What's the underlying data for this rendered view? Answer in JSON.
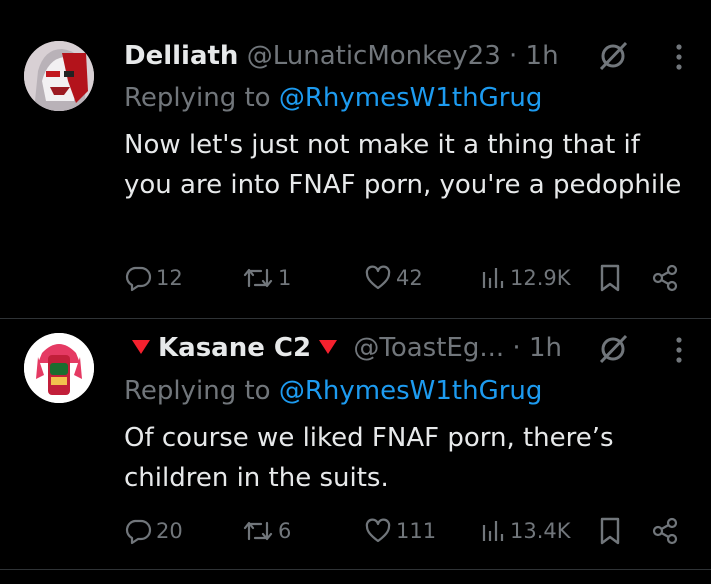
{
  "tweets": [
    {
      "display_name": "Delliath",
      "handle": "@LunaticMonkey23",
      "sep": "·",
      "time": "1h",
      "replying_prefix": "Replying to",
      "replying_to": "@RhymesW1thGrug",
      "text": "Now let's just not make it a thing that if you are into FNAF porn, you're a pedophile",
      "replies": "12",
      "reposts": "1",
      "likes": "42",
      "views": "12.9K"
    },
    {
      "display_name": "Kasane C2",
      "handle": "@ToastEg...",
      "sep": "·",
      "time": "1h",
      "replying_prefix": "Replying to",
      "replying_to": "@RhymesW1thGrug",
      "text": "Of course we liked FNAF porn, there’s children in the suits.",
      "replies": "20",
      "reposts": "6",
      "likes": "111",
      "views": "13.4K"
    }
  ],
  "icons": [
    "grok-icon",
    "more-icon",
    "reply-icon",
    "repost-icon",
    "like-icon",
    "views-icon",
    "bookmark-icon",
    "share-icon"
  ],
  "colors": {
    "background": "#000000",
    "text": "#e7e9ea",
    "muted": "#71767b",
    "link": "#1d9bf0",
    "divider": "#2f3336",
    "flag_red": "#f4212e"
  }
}
